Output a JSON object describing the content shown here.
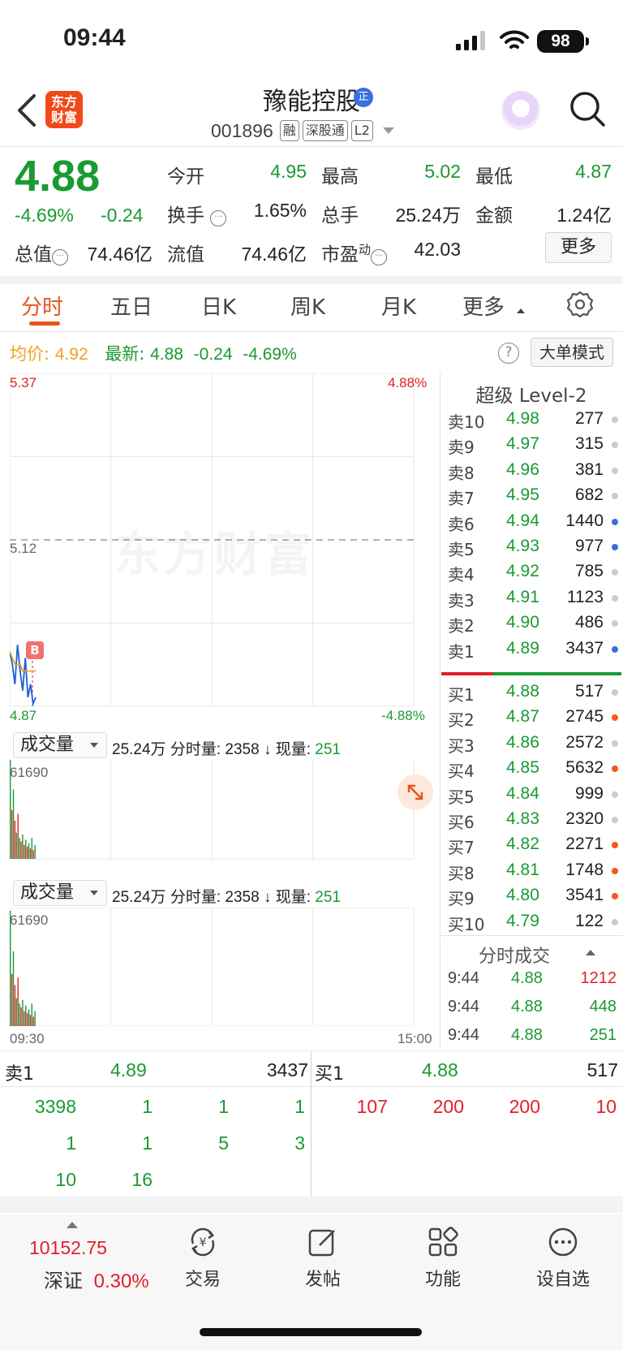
{
  "status_bar": {
    "time": "09:44",
    "battery": "98"
  },
  "header": {
    "logo_line1": "东方",
    "logo_line2": "财富",
    "stock_name": "豫能控股",
    "name_badge": "正",
    "stock_code": "001896",
    "tags": [
      "融",
      "深股通",
      "L2"
    ]
  },
  "quote": {
    "price": "4.88",
    "change_pct": "-4.69%",
    "change_val": "-0.24",
    "fields": [
      {
        "label": "今开",
        "value": "4.95",
        "color": "green"
      },
      {
        "label": "最高",
        "value": "5.02",
        "color": "green"
      },
      {
        "label": "最低",
        "value": "4.87",
        "color": "green"
      },
      {
        "label": "换手",
        "value": "1.65%",
        "color": "black"
      },
      {
        "label": "总手",
        "value": "25.24万",
        "color": "black"
      },
      {
        "label": "金额",
        "value": "1.24亿",
        "color": "black"
      },
      {
        "label": "总值",
        "value": "74.46亿",
        "color": "black"
      },
      {
        "label": "流值",
        "value": "74.46亿",
        "color": "black"
      },
      {
        "label": "市盈",
        "superscript": "动",
        "value": "42.03",
        "color": "black"
      }
    ],
    "more_label": "更多"
  },
  "tabs": [
    "分时",
    "五日",
    "日K",
    "周K",
    "月K",
    "更多"
  ],
  "avg_row": {
    "avg_label": "均价:",
    "avg_value": "4.92",
    "latest_label": "最新:",
    "latest_value": "4.88",
    "latest_change": "-0.24",
    "latest_pct": "-4.69%",
    "help": "?",
    "big_order_label": "大单模式"
  },
  "main_chart": {
    "price_top": "5.37",
    "price_mid": "5.12",
    "price_bottom": "4.87",
    "pct_top": "4.88%",
    "pct_bottom": "-4.88%",
    "marker": "B",
    "watermark": "东方财富",
    "time_start": "09:30",
    "time_end": "15:00"
  },
  "chart_data": {
    "type": "line",
    "title": "",
    "ylim": [
      4.87,
      5.37
    ],
    "prev_close": 5.12,
    "series": [
      {
        "values": [
          4.95,
          4.93,
          4.9,
          4.96,
          4.92,
          4.89,
          4.94,
          4.88,
          4.9,
          4.87,
          4.88
        ]
      },
      {
        "values": [
          4.95,
          4.94,
          4.93,
          4.93,
          4.93,
          4.92,
          4.92,
          4.92,
          4.92,
          4.92,
          4.92
        ]
      }
    ],
    "volume_max": 61690,
    "volumes": [
      61690,
      28000,
      40000,
      22000,
      15000,
      26000,
      12000,
      10000,
      14000,
      8000,
      11000,
      7000,
      9000,
      6000,
      12000,
      5000,
      8000
    ],
    "volume_colors": [
      "green",
      "red",
      "green",
      "red",
      "green",
      "red",
      "green",
      "red",
      "green",
      "red",
      "green",
      "red",
      "green",
      "red",
      "green",
      "red",
      "green"
    ]
  },
  "volume_panels": [
    {
      "select": "成交量",
      "total": "25.24万",
      "tick_label": "分时量:",
      "tick_value": "2358",
      "now_label": "现量:",
      "now_value": "251",
      "max": "61690"
    },
    {
      "select": "成交量",
      "total": "25.24万",
      "tick_label": "分时量:",
      "tick_value": "2358",
      "now_label": "现量:",
      "now_value": "251",
      "max": "61690"
    }
  ],
  "order_book": {
    "title": "超级 Level-2",
    "asks": [
      {
        "label": "卖10",
        "price": "4.98",
        "vol": "277",
        "dot": "#cccccc"
      },
      {
        "label": "卖9",
        "price": "4.97",
        "vol": "315",
        "dot": "#cccccc"
      },
      {
        "label": "卖8",
        "price": "4.96",
        "vol": "381",
        "dot": "#cccccc"
      },
      {
        "label": "卖7",
        "price": "4.95",
        "vol": "682",
        "dot": "#cccccc"
      },
      {
        "label": "卖6",
        "price": "4.94",
        "vol": "1440",
        "dot": "#3a6fe0"
      },
      {
        "label": "卖5",
        "price": "4.93",
        "vol": "977",
        "dot": "#3a6fe0"
      },
      {
        "label": "卖4",
        "price": "4.92",
        "vol": "785",
        "dot": "#cccccc"
      },
      {
        "label": "卖3",
        "price": "4.91",
        "vol": "1123",
        "dot": "#cccccc"
      },
      {
        "label": "卖2",
        "price": "4.90",
        "vol": "486",
        "dot": "#cccccc"
      },
      {
        "label": "卖1",
        "price": "4.89",
        "vol": "3437",
        "dot": "#3a6fe0"
      }
    ],
    "bids": [
      {
        "label": "买1",
        "price": "4.88",
        "vol": "517",
        "dot": "#cccccc"
      },
      {
        "label": "买2",
        "price": "4.87",
        "vol": "2745",
        "dot": "#f05a1a"
      },
      {
        "label": "买3",
        "price": "4.86",
        "vol": "2572",
        "dot": "#cccccc"
      },
      {
        "label": "买4",
        "price": "4.85",
        "vol": "5632",
        "dot": "#f05a1a"
      },
      {
        "label": "买5",
        "price": "4.84",
        "vol": "999",
        "dot": "#cccccc"
      },
      {
        "label": "买6",
        "price": "4.83",
        "vol": "2320",
        "dot": "#cccccc"
      },
      {
        "label": "买7",
        "price": "4.82",
        "vol": "2271",
        "dot": "#f05a1a"
      },
      {
        "label": "买8",
        "price": "4.81",
        "vol": "1748",
        "dot": "#f05a1a"
      },
      {
        "label": "买9",
        "price": "4.80",
        "vol": "3541",
        "dot": "#f05a1a"
      },
      {
        "label": "买10",
        "price": "4.79",
        "vol": "122",
        "dot": "#cccccc"
      }
    ]
  },
  "ticks": {
    "title": "分时成交",
    "rows": [
      {
        "time": "9:44",
        "price": "4.88",
        "vol": "1212",
        "vol_color": "red"
      },
      {
        "time": "9:44",
        "price": "4.88",
        "vol": "448",
        "vol_color": "green"
      },
      {
        "time": "9:44",
        "price": "4.88",
        "vol": "251",
        "vol_color": "green"
      }
    ]
  },
  "queue": {
    "sell_label": "卖1",
    "sell_price": "4.89",
    "sell_vol": "3437",
    "buy_label": "买1",
    "buy_price": "4.88",
    "buy_vol": "517",
    "sell_rows": [
      [
        "3398",
        "1",
        "1",
        "1"
      ],
      [
        "1",
        "1",
        "5",
        "3"
      ],
      [
        "10",
        "16",
        "",
        ""
      ]
    ],
    "buy_rows": [
      [
        "107",
        "200",
        "200",
        "10"
      ]
    ]
  },
  "bottom_nav": {
    "index_value": "10152.75",
    "index_name": "深证",
    "index_pct": "0.30%",
    "items": [
      "交易",
      "发帖",
      "功能",
      "设自选"
    ]
  },
  "colors": {
    "green": "#1a9a32",
    "red": "#e0202a",
    "accent": "#e8541d"
  }
}
